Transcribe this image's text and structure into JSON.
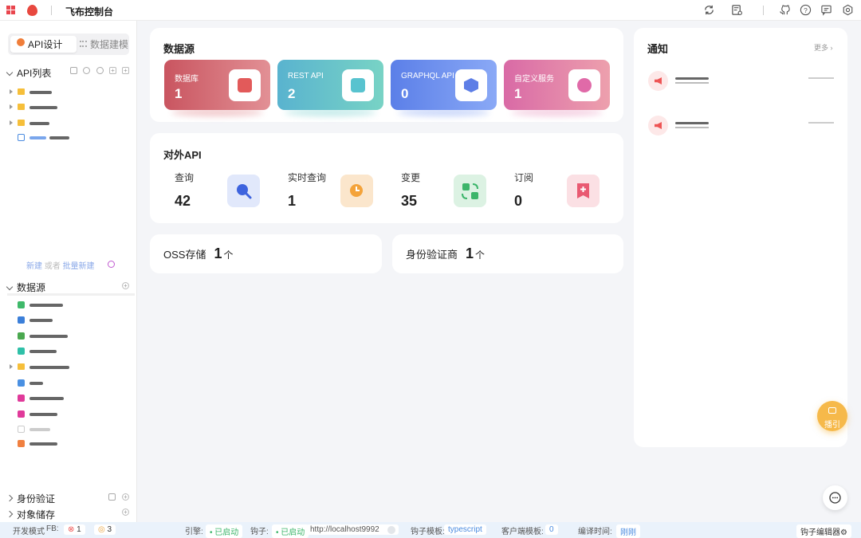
{
  "app": {
    "title": "飞布控制台"
  },
  "sidebar": {
    "tabs": [
      "API设计",
      "数据建模"
    ],
    "api_list": {
      "title": "API列表"
    },
    "links": {
      "new": "新建",
      "or": "或者",
      "batch": "批量新建"
    },
    "datasource": {
      "title": "数据源"
    },
    "auth": {
      "title": "身份验证"
    },
    "storage": {
      "title": "对象储存"
    }
  },
  "datasource": {
    "title": "数据源",
    "cards": [
      {
        "label": "数据库",
        "count": "1"
      },
      {
        "label": "REST API",
        "count": "2"
      },
      {
        "label": "GRAPHQL API",
        "count": "0"
      },
      {
        "label": "自定义服务",
        "count": "1"
      }
    ]
  },
  "external_api": {
    "title": "对外API",
    "items": [
      {
        "label": "查询",
        "count": "42",
        "icon": "search-icon"
      },
      {
        "label": "实时查询",
        "count": "1",
        "icon": "clock-icon"
      },
      {
        "label": "变更",
        "count": "35",
        "icon": "swap-icon"
      },
      {
        "label": "订阅",
        "count": "0",
        "icon": "bookmark-plus-icon"
      }
    ]
  },
  "oss": {
    "label": "OSS存储",
    "count": "1",
    "unit": "个"
  },
  "identity": {
    "label": "身份验证商",
    "count": "1",
    "unit": "个"
  },
  "notice": {
    "title": "通知",
    "more": "更多 ›"
  },
  "fab": {
    "label": "播引"
  },
  "statusbar": {
    "mode": "开发模式",
    "fb": "FB:",
    "errors": "1",
    "warnings": "3",
    "engine_label": "引擎:",
    "engine_status": "• 已启动",
    "hook_label": "钩子:",
    "hook_status": "• 已启动",
    "hook_url": "http://localhost9992",
    "hook_template_label": "钩子模板:",
    "hook_template": "typescript",
    "client_template_label": "客户端模板:",
    "client_template": "0",
    "compile_label": "编译时间:",
    "compile_time": "刚刚",
    "editor": "钩子编辑器⚙"
  },
  "colors": {
    "accent": "#4a8be0",
    "bg": "#f4f5f8"
  }
}
